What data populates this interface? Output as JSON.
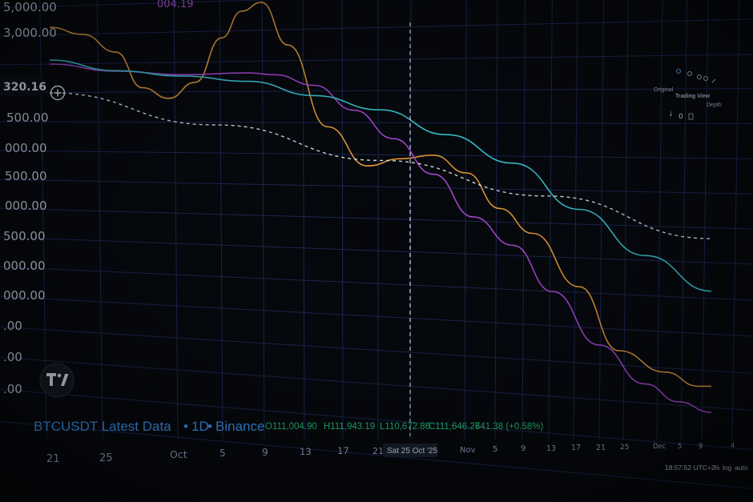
{
  "chart_data": {
    "type": "line",
    "title": "BTCUSDT Latest Data",
    "interval": "1D",
    "exchange": "Binance",
    "ohlc": {
      "open": "O111,004.90",
      "high": "H111,943.19",
      "low": "L110,672.86",
      "close": "C111,646.27",
      "change": "641.38 (+0.58%)"
    },
    "top_value_label": "004.19",
    "price_label": "320.16",
    "y_tick_labels": [
      "5,000.00",
      "3,000.00",
      "500.00",
      "000.00",
      "500.00",
      "000.00",
      "500.00",
      "000.00",
      "000.00",
      ".00",
      ".00",
      "00",
      ".00"
    ],
    "x_tick_labels": [
      "21",
      "25",
      "Oct",
      "5",
      "9",
      "13",
      "17",
      "21",
      "Nov",
      "5",
      "9",
      "13",
      "17",
      "21",
      "25",
      "Dec",
      "5",
      "9",
      "4"
    ],
    "crosshair_date": "Sat 25 Oct '25",
    "series": [
      {
        "color": "#f5a43a",
        "points": [
          [
            0,
            0.0
          ],
          [
            0.05,
            0.04
          ],
          [
            0.1,
            0.14
          ],
          [
            0.14,
            0.34
          ],
          [
            0.18,
            0.4
          ],
          [
            0.22,
            0.31
          ],
          [
            0.26,
            0.06
          ],
          [
            0.29,
            -0.09
          ],
          [
            0.32,
            -0.14
          ],
          [
            0.36,
            0.1
          ],
          [
            0.42,
            0.56
          ],
          [
            0.48,
            0.78
          ],
          [
            0.53,
            0.74
          ],
          [
            0.58,
            0.72
          ],
          [
            0.63,
            0.82
          ],
          [
            0.68,
            1.02
          ],
          [
            0.73,
            1.16
          ],
          [
            0.8,
            1.46
          ],
          [
            0.86,
            1.82
          ],
          [
            0.93,
            1.94
          ],
          [
            0.98,
            2.02
          ],
          [
            1.0,
            2.02
          ]
        ]
      },
      {
        "color": "#b24be0",
        "points": [
          [
            0,
            0.0
          ],
          [
            0.1,
            0.04
          ],
          [
            0.2,
            0.06
          ],
          [
            0.3,
            0.05
          ],
          [
            0.34,
            0.06
          ],
          [
            0.4,
            0.12
          ],
          [
            0.46,
            0.26
          ],
          [
            0.52,
            0.42
          ],
          [
            0.58,
            0.62
          ],
          [
            0.64,
            0.86
          ],
          [
            0.7,
            1.02
          ],
          [
            0.76,
            1.28
          ],
          [
            0.83,
            1.58
          ],
          [
            0.9,
            1.8
          ],
          [
            0.95,
            1.9
          ],
          [
            1.0,
            1.96
          ]
        ]
      },
      {
        "color": "#3ed5de",
        "points": [
          [
            0,
            0.0
          ],
          [
            0.1,
            0.06
          ],
          [
            0.2,
            0.09
          ],
          [
            0.3,
            0.12
          ],
          [
            0.4,
            0.2
          ],
          [
            0.5,
            0.28
          ],
          [
            0.6,
            0.42
          ],
          [
            0.7,
            0.58
          ],
          [
            0.8,
            0.84
          ],
          [
            0.9,
            1.1
          ],
          [
            1.0,
            1.3
          ]
        ]
      },
      {
        "color": "#e9eef7",
        "style": "dashed",
        "points": [
          [
            0,
            0.0
          ],
          [
            0.25,
            0.18
          ],
          [
            0.5,
            0.38
          ],
          [
            0.75,
            0.58
          ],
          [
            1.0,
            0.82
          ]
        ]
      }
    ]
  },
  "toolbar": {
    "tab_original": "Original",
    "tab_tradingview": "Trading View",
    "tab_depth": "Depth"
  },
  "status": {
    "clock": "18:57:52 UTC+2",
    "percent": "%",
    "log": "log",
    "auto": "auto"
  }
}
